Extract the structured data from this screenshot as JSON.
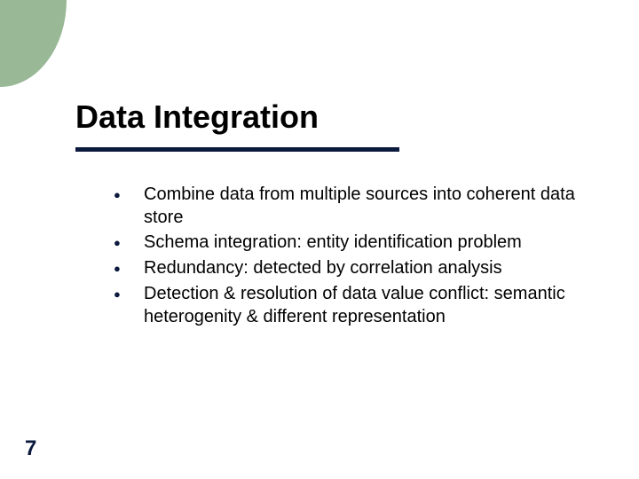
{
  "title": "Data Integration",
  "bullets": [
    "Combine data from multiple sources into coherent data store",
    "Schema integration: entity identification problem",
    "Redundancy: detected by correlation analysis",
    "Detection & resolution of data value conflict: semantic heterogenity & different representation"
  ],
  "page_number": "7",
  "colors": {
    "accent_green": "#98b896",
    "accent_navy": "#0b193d"
  }
}
